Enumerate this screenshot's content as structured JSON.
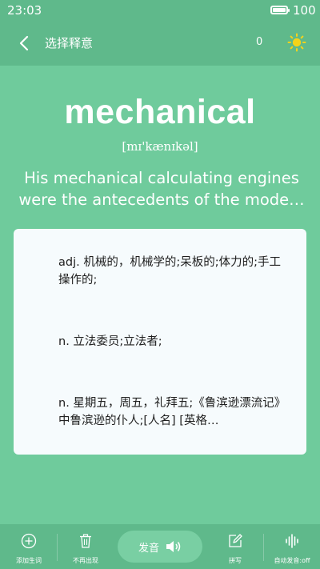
{
  "status": {
    "time": "23:03",
    "battery": "100"
  },
  "header": {
    "title": "选择释意",
    "count": "0"
  },
  "word": {
    "text": "mechanical",
    "phonetic": "[mɪ'kænɪkəl]",
    "sentence": "His mechanical calculating engines were the antecedents of the mode…"
  },
  "options": [
    {
      "text": "adj. 机械的，机械学的;呆板的;体力的;手工操作的;"
    },
    {
      "text": "n. 立法委员;立法者;"
    },
    {
      "text": "n. 星期五，周五，礼拜五;《鲁滨逊漂流记》中鲁滨逊的仆人;[人名] [英格…"
    }
  ],
  "bottom": {
    "add": "添加生词",
    "remove": "不再出现",
    "voice": "发音",
    "spell": "拼写",
    "auto": "自动发音:off"
  },
  "colors": {
    "background": "#6fcb9c",
    "bar": "#5fb98b",
    "card": "#f6fbfd",
    "sun": "#f5d31a"
  },
  "icons": [
    "back-icon",
    "sun-icon",
    "add-circle-icon",
    "trash-icon",
    "speaker-icon",
    "edit-icon",
    "sound-wave-icon"
  ]
}
